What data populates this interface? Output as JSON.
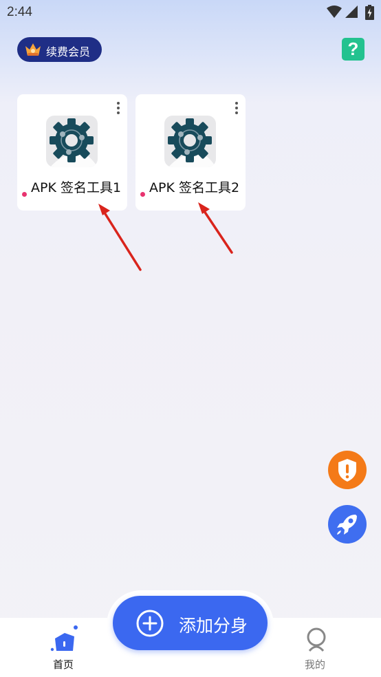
{
  "status_bar": {
    "time": "2:44"
  },
  "header": {
    "vip_label": "续费会员",
    "help_label": "?"
  },
  "apps": [
    {
      "name": "APK 签名工具1"
    },
    {
      "name": "APK 签名工具2"
    }
  ],
  "add_button": {
    "label": "添加分身"
  },
  "bottom_nav": {
    "home_label": "首页",
    "mine_label": "我的"
  },
  "colors": {
    "vip_bg": "#1f2e86",
    "help_green": "#23c28f",
    "accent_blue": "#3b68f0",
    "shield_orange": "#f47a18",
    "running_dot": "#e8336f",
    "arrow_red": "#d9241c"
  },
  "icons": [
    "wifi-icon",
    "signal-icon",
    "battery-charging-icon",
    "crown-icon",
    "gear-app-icon",
    "more-vertical-icon",
    "shield-alert-icon",
    "rocket-icon",
    "plus-circle-icon",
    "home-icon",
    "profile-icon"
  ]
}
